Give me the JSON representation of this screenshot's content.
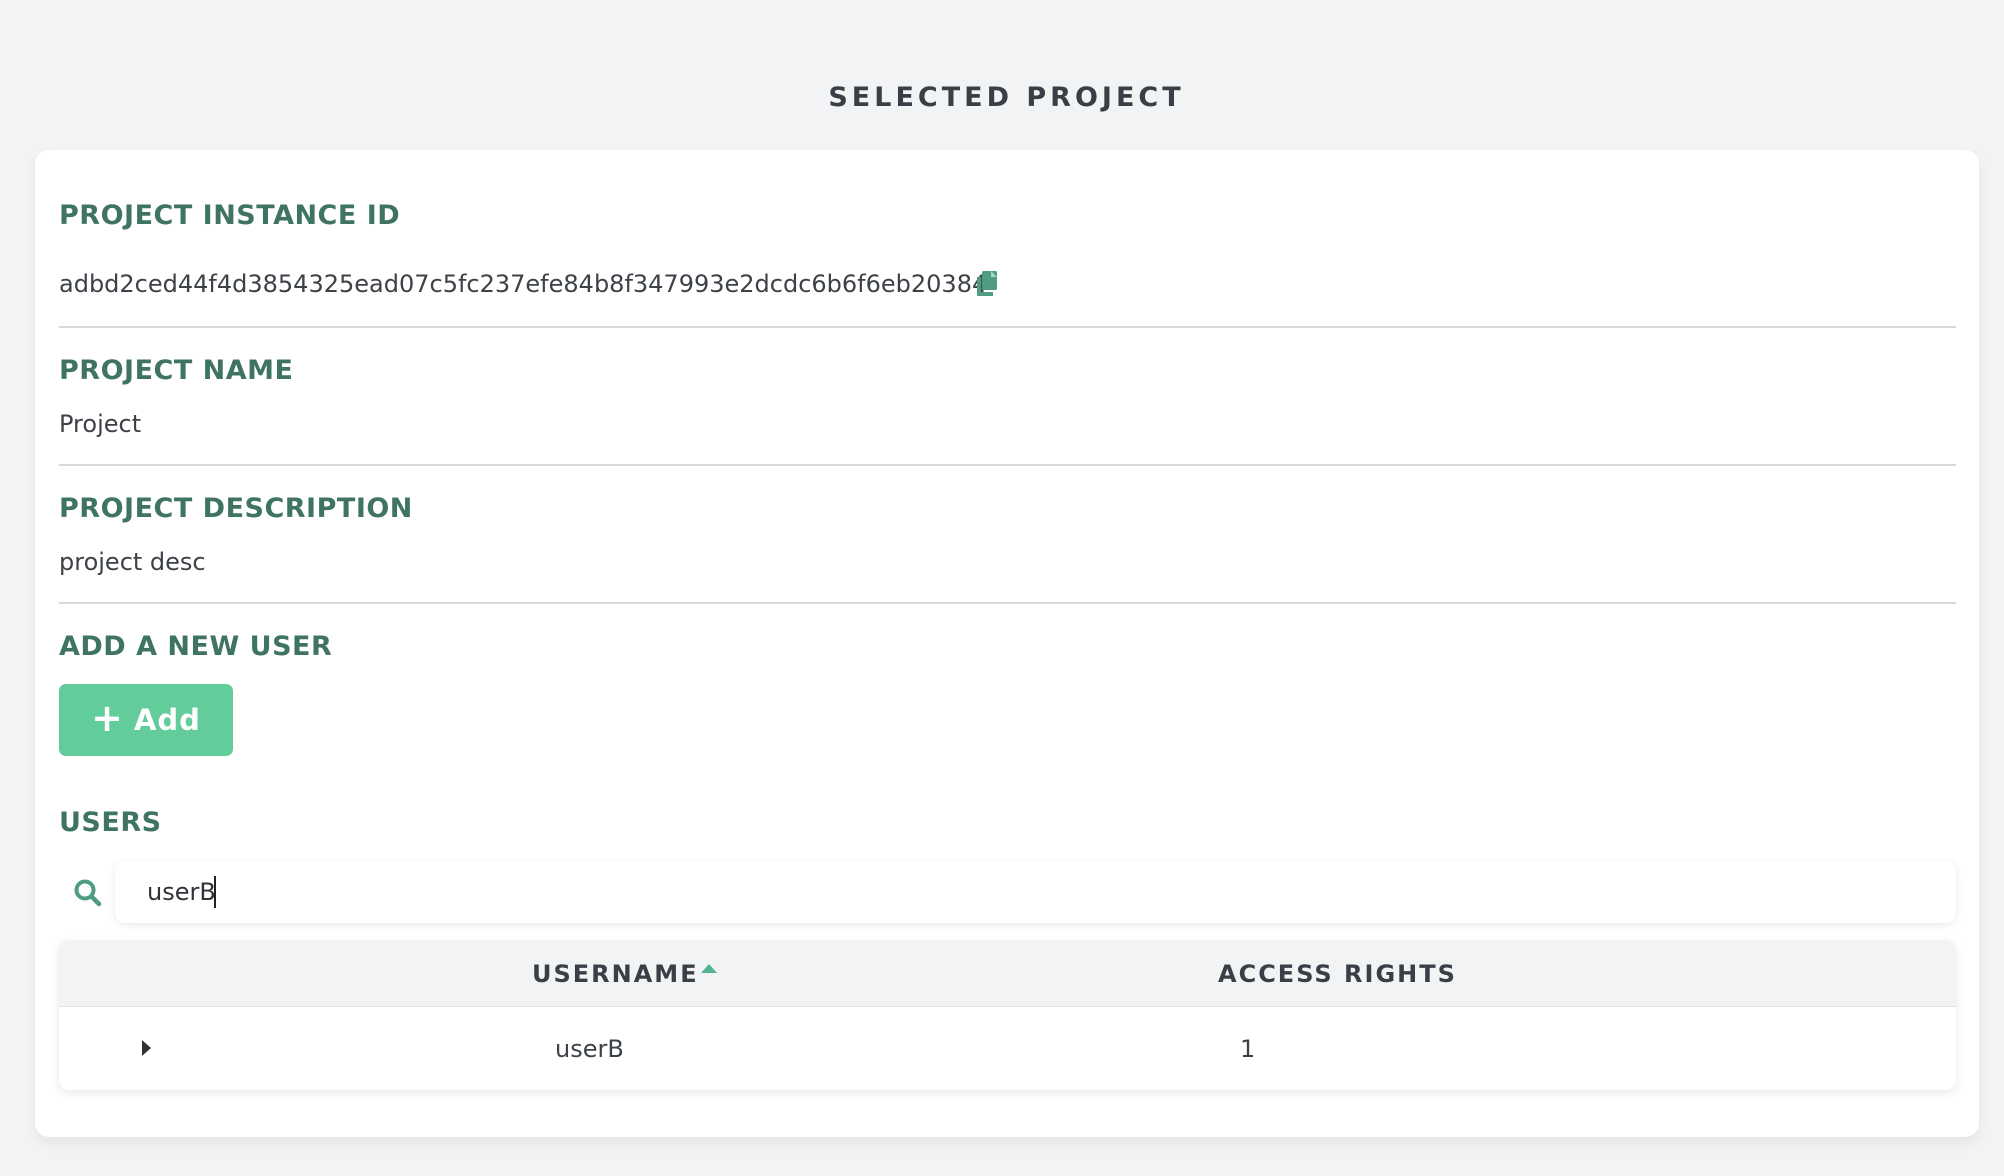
{
  "page": {
    "title": "SELECTED PROJECT"
  },
  "project": {
    "instance_id_heading": "PROJECT INSTANCE ID",
    "instance_id": "adbd2ced44f4d3854325ead07c5fc237efe84b8f347993e2dcdc6b6f6eb20384",
    "name_heading": "PROJECT NAME",
    "name": "Project",
    "description_heading": "PROJECT DESCRIPTION",
    "description": "project desc"
  },
  "add_user": {
    "heading": "ADD A NEW USER",
    "button_label": "Add",
    "button_icon": "plus-icon"
  },
  "users": {
    "heading": "USERS",
    "search_value": "userB",
    "search_icon": "search-icon",
    "columns": [
      "USERNAME",
      "ACCESS RIGHTS"
    ],
    "sort": {
      "column": "USERNAME",
      "direction": "ascending"
    },
    "rows": [
      {
        "username": "userB",
        "access_rights": "1"
      }
    ]
  },
  "colors": {
    "accent_heading": "#3f7462",
    "add_button": "#62cc9b",
    "icon_teal": "#54b38d",
    "background": "#f2f3f5"
  }
}
